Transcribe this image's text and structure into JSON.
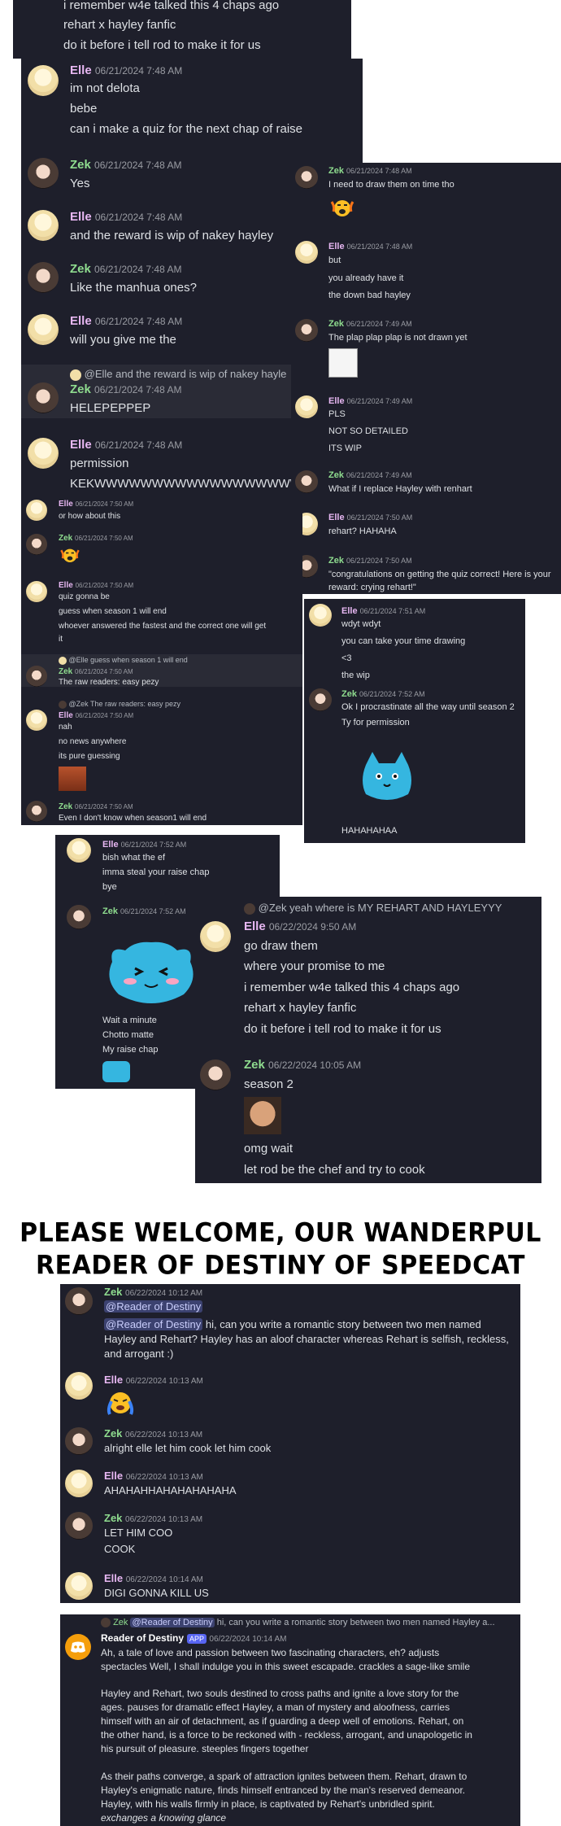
{
  "p1": {
    "lines": [
      "i remember w4e talked this 4 chaps ago",
      "rehart x hayley fanfic",
      "do it before i tell rod to make it for us"
    ]
  },
  "p2": {
    "messages": [
      {
        "name": "Elle",
        "ts": "06/21/2024 7:48 AM",
        "lines": [
          "im not delota",
          "bebe",
          "can i make a quiz for the next chap of raise"
        ]
      },
      {
        "name": "Zek",
        "ts": "06/21/2024 7:48 AM",
        "lines": [
          "Yes"
        ]
      },
      {
        "name": "Elle",
        "ts": "06/21/2024 7:48 AM",
        "lines": [
          "and the reward is wip of nakey hayley"
        ]
      },
      {
        "name": "Zek",
        "ts": "06/21/2024 7:48 AM",
        "lines": [
          "Like the manhua ones?"
        ]
      },
      {
        "name": "Elle",
        "ts": "06/21/2024 7:48 AM",
        "lines": [
          "will you give me the"
        ]
      },
      {
        "reply": "@Elle and the reward is wip of nakey hayle",
        "name": "Zek",
        "ts": "06/21/2024 7:48 AM",
        "lines": [
          "HELEPEPPEP"
        ]
      },
      {
        "name": "Elle",
        "ts": "06/21/2024 7:48 AM",
        "lines": [
          "permission",
          "KEKWWWWWWWWWWWWWWWWWWWW"
        ]
      }
    ]
  },
  "p3": {
    "messages": [
      {
        "name": "Zek",
        "ts": "06/21/2024 7:48 AM",
        "lines": [
          "I need to draw them on time tho"
        ]
      },
      {
        "name": "Elle",
        "ts": "06/21/2024 7:48 AM",
        "lines": [
          "but",
          "you already have it",
          "the down bad hayley"
        ]
      },
      {
        "name": "Zek",
        "ts": "06/21/2024 7:49 AM",
        "lines": [
          "The plap plap plap is not drawn yet"
        ]
      },
      {
        "name": "Elle",
        "ts": "06/21/2024 7:49 AM",
        "lines": [
          "PLS",
          "NOT SO DETAILED",
          "ITS WIP"
        ]
      },
      {
        "name": "Zek",
        "ts": "06/21/2024 7:49 AM",
        "lines": [
          "What if I replace Hayley with renhart"
        ]
      },
      {
        "name": "Elle",
        "ts": "06/21/2024 7:50 AM",
        "lines": [
          "rehart? HAHAHA"
        ]
      },
      {
        "name": "Zek",
        "ts": "06/21/2024 7:50 AM",
        "lines": [
          "\"congratulations on getting the quiz correct! Here is your",
          "reward: crying rehart!\""
        ]
      }
    ]
  },
  "p4": {
    "messages": [
      {
        "name": "Elle",
        "ts": "06/21/2024 7:50 AM",
        "lines": [
          "or how about this"
        ]
      },
      {
        "name": "Zek",
        "ts": "06/21/2024 7:50 AM",
        "lines": []
      },
      {
        "name": "Elle",
        "ts": "06/21/2024 7:50 AM",
        "lines": [
          "quiz gonna be",
          "guess when season 1 will end",
          "whoever answered the fastest and the correct one will get",
          "it"
        ]
      },
      {
        "reply": "@Elle guess when season 1 will end",
        "name": "Zek",
        "ts": "06/21/2024 7:50 AM",
        "lines": [
          "The raw readers: easy pezy"
        ]
      },
      {
        "reply": "@Zek The raw readers: easy pezy",
        "name": "Elle",
        "ts": "06/21/2024 7:50 AM",
        "lines": [
          "nah",
          "no news anywhere",
          "its pure guessing"
        ]
      },
      {
        "name": "Zek",
        "ts": "06/21/2024 7:50 AM",
        "lines": [
          "Even I don't know when season1 will end"
        ]
      }
    ]
  },
  "p5": {
    "messages": [
      {
        "name": "Elle",
        "ts": "06/21/2024 7:51 AM",
        "lines": [
          "wdyt wdyt",
          "you can take your time drawing",
          "<3",
          "the wip"
        ]
      },
      {
        "name": "Zek",
        "ts": "06/21/2024 7:52 AM",
        "lines": [
          "Ok I procrastinate all the way until season 2",
          "Ty for permission"
        ]
      }
    ],
    "tail": "HAHAHAHAA"
  },
  "p6": {
    "messages": [
      {
        "name": "Elle",
        "ts": "06/21/2024 7:52 AM",
        "lines": [
          "bish what the ef",
          "imma steal your raise chap",
          "bye"
        ]
      },
      {
        "name": "Zek",
        "ts": "06/21/2024 7:52 AM",
        "lines": [
          "Wait a minute",
          "Chotto matte",
          "My raise chap"
        ]
      }
    ]
  },
  "p7": {
    "reply": "@Zek yeah where is MY REHART AND HAYLEYYY",
    "messages": [
      {
        "name": "Elle",
        "ts": "06/22/2024 9:50 AM",
        "lines": [
          "go draw them",
          "where your promise to me",
          "i remember w4e talked this 4 chaps ago",
          "rehart x hayley fanfic",
          "do it before i tell rod to make it for us"
        ]
      },
      {
        "name": "Zek",
        "ts": "06/22/2024 10:05 AM",
        "lines": [
          "season 2",
          "omg wait",
          "let rod be the chef and try to cook"
        ]
      }
    ]
  },
  "title": {
    "line1": "PLEASE WELCOME, OUR WANDERPUL",
    "line2": "READER OF DESTINY OF SPEEDCAT"
  },
  "p8": {
    "messages": [
      {
        "name": "Zek",
        "ts": "06/22/2024 10:12 AM",
        "mention": "@Reader of Destiny",
        "lines": [
          "hi, can you write a romantic story between two men named",
          "Hayley and Rehart? Hayley has an aloof character whereas Rehart is selfish, reckless,",
          "and arrogant :)"
        ]
      },
      {
        "name": "Elle",
        "ts": "06/22/2024 10:13 AM",
        "lines": []
      },
      {
        "name": "Zek",
        "ts": "06/22/2024 10:13 AM",
        "lines": [
          "alright elle let him cook let him cook"
        ]
      },
      {
        "name": "Elle",
        "ts": "06/22/2024 10:13 AM",
        "lines": [
          "AHAHAHHAHAHAHAHAHA"
        ]
      },
      {
        "name": "Zek",
        "ts": "06/22/2024 10:13 AM",
        "lines": [
          "LET HIM COO",
          "COOK"
        ]
      },
      {
        "name": "Elle",
        "ts": "06/22/2024 10:14 AM",
        "lines": [
          "DIGI GONNA KILL US"
        ]
      }
    ]
  },
  "p9": {
    "reply_name": "Zek",
    "reply_mention": "@Reader of Destiny",
    "reply_text": "hi, can you write a romantic story between two men named Hayley a...",
    "name": "Reader of Destiny",
    "app": "APP",
    "ts": "06/22/2024 10:14 AM",
    "para1": [
      "Ah, a tale of love and passion between two fascinating characters, eh? adjusts",
      "spectacles Well, I shall indulge you in this sweet escapade. crackles a sage-like smile"
    ],
    "para2": [
      "Hayley and Rehart, two souls destined to cross paths and ignite a love story for the",
      "ages. pauses for dramatic effect Hayley, a man of mystery and aloofness, carries",
      "himself with an air of detachment, as if guarding a deep well of emotions. Rehart, on",
      "the other hand, is a force to be reckoned with - reckless, arrogant, and unapologetic in",
      "his pursuit of pleasure. steeples fingers together"
    ],
    "para3": [
      "As their paths converge, a spark of attraction ignites between them. Rehart, drawn to",
      "Hayley's enigmatic nature, finds himself entranced by the man's reserved demeanor.",
      "Hayley, with his walls firmly in place, is captivated by Rehart's unbridled spirit.",
      "exchanges a knowing glance"
    ]
  }
}
